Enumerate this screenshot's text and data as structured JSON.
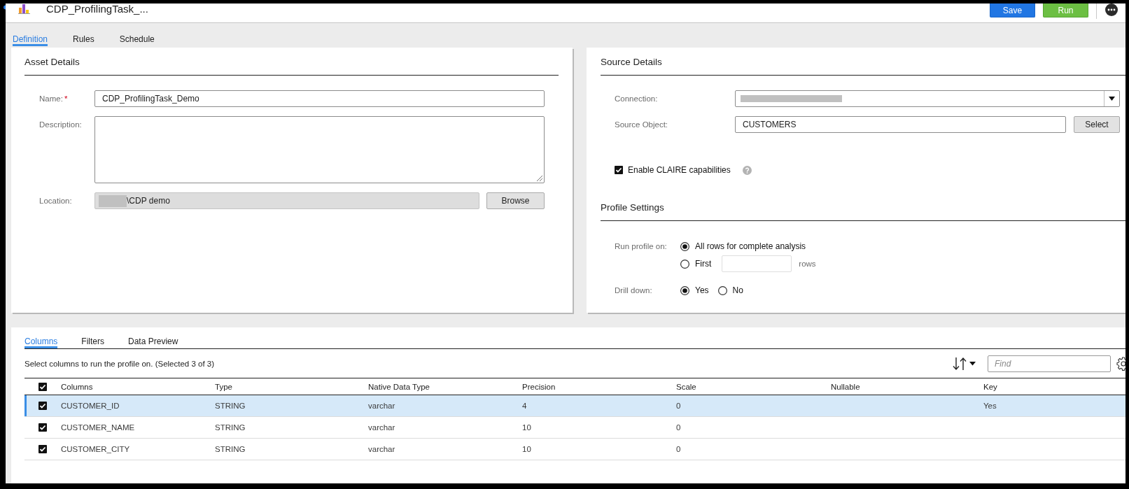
{
  "header": {
    "title": "CDP_ProfilingTask_...",
    "buttons": [
      {
        "label": "Save",
        "kind": "save"
      },
      {
        "label": "Run",
        "kind": "run"
      }
    ]
  },
  "tabs": [
    {
      "label": "Definition",
      "selected": true
    },
    {
      "label": "Rules",
      "selected": false
    },
    {
      "label": "Schedule",
      "selected": false
    }
  ],
  "asset_details": {
    "title": "Asset Details",
    "fields": [
      {
        "kind": "text",
        "label": "Name:",
        "required_mark": "*",
        "value": "CDP_ProfilingTask_Demo"
      },
      {
        "kind": "textarea",
        "label": "Description:"
      },
      {
        "kind": "location",
        "label": "Location:",
        "redacted": true,
        "value": "\\CDP demo",
        "button": "Browse"
      }
    ]
  },
  "source_details": {
    "title": "Source Details",
    "fields": [
      {
        "kind": "dropdown",
        "label": "Connection:",
        "redacted": true
      },
      {
        "kind": "object",
        "label": "Source Object:",
        "value": "CUSTOMERS",
        "button": "Select"
      }
    ],
    "claire": {
      "label": "Enable CLAIRE capabilities",
      "checked": true
    }
  },
  "profile_settings": {
    "title": "Profile Settings",
    "groups": [
      {
        "kind": "stacked",
        "label": "Run profile on:",
        "options": [
          {
            "label": "All rows for complete analysis",
            "selected": true
          },
          {
            "label": "First",
            "selected": false,
            "count_field": true,
            "suffix": "rows"
          }
        ]
      },
      {
        "kind": "inline",
        "label": "Drill down:",
        "options": [
          {
            "label": "Yes",
            "selected": true
          },
          {
            "label": "No",
            "selected": false
          }
        ]
      }
    ]
  },
  "columns_panel": {
    "tabs": [
      {
        "label": "Columns",
        "selected": true
      },
      {
        "label": "Filters",
        "selected": false
      },
      {
        "label": "Data Preview",
        "selected": false
      }
    ],
    "summary": "Select columns to run the profile on. (Selected 3 of 3)",
    "find": {
      "placeholder": "Find"
    },
    "table": {
      "all_checked": true,
      "columns": [
        "Columns",
        "Type",
        "Native Data Type",
        "Precision",
        "Scale",
        "Nullable",
        "Key"
      ],
      "rows": [
        {
          "selected": true,
          "checked": true,
          "name": "CUSTOMER_ID",
          "type": "STRING",
          "native_type": "varchar",
          "precision": "4",
          "scale": "0",
          "key": "Yes"
        },
        {
          "selected": false,
          "checked": true,
          "name": "CUSTOMER_NAME",
          "type": "STRING",
          "native_type": "varchar",
          "precision": "10",
          "scale": "0"
        },
        {
          "selected": false,
          "checked": true,
          "name": "CUSTOMER_CITY",
          "type": "STRING",
          "native_type": "varchar",
          "precision": "10",
          "scale": "0"
        }
      ]
    }
  }
}
